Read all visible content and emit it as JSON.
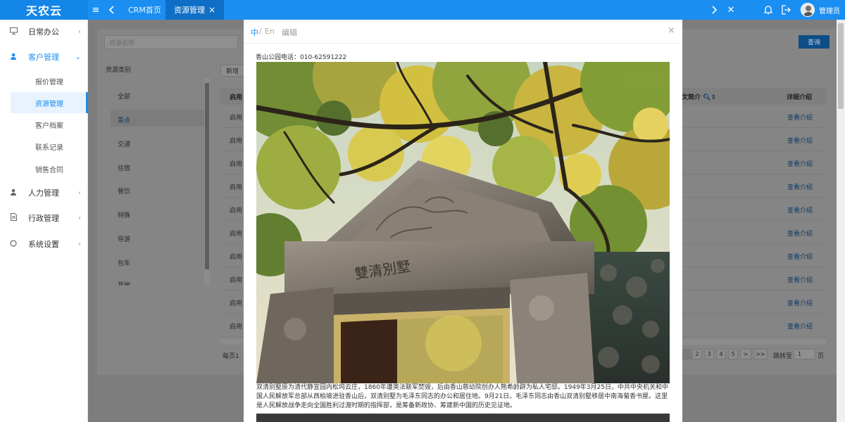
{
  "topbar": {
    "logo": "天农云",
    "tabs": [
      {
        "label": "CRM首页"
      },
      {
        "label": "资源管理",
        "close": "×"
      }
    ],
    "close_all": "✕",
    "username": "管理员"
  },
  "sidebar": {
    "items": [
      {
        "label": "日常办公",
        "icon": "monitor-icon"
      },
      {
        "label": "客户管理",
        "icon": "user-icon",
        "open": true
      },
      {
        "label": "人力管理",
        "icon": "user-icon"
      },
      {
        "label": "行政管理",
        "icon": "document-icon"
      },
      {
        "label": "系统设置",
        "icon": "circle-icon"
      }
    ],
    "sub_items": [
      {
        "label": "报价管理"
      },
      {
        "label": "资源管理",
        "active": true
      },
      {
        "label": "客户档案"
      },
      {
        "label": "联系记录"
      },
      {
        "label": "销售合同"
      }
    ]
  },
  "main": {
    "search_placeholder": "资源名称",
    "query_label": "查询",
    "category_title": "资源类别",
    "categories": [
      "全部",
      "景点",
      "交通",
      "住宿",
      "餐饮",
      "特殊",
      "导游",
      "包车",
      "其他"
    ],
    "selected_category": "景点",
    "add_label": "新增",
    "table": {
      "col_state": "启用",
      "col_brief": "文简介",
      "col_detail": "详细介绍",
      "row_state": "启用",
      "row_link": "查看介绍",
      "row_count": 10
    },
    "pagination": {
      "per_page_label": "每页",
      "per_page_value": "1",
      "pages": [
        "2",
        "3",
        "4",
        "5"
      ],
      "next": ">",
      "last": ">>",
      "jump_label": "跳转至",
      "jump_value": "1",
      "page_suffix": "页"
    }
  },
  "modal": {
    "lang_zh": "中",
    "lang_sep": "/",
    "lang_en": "En",
    "edit_label": "编辑",
    "close": "×",
    "phone_line": "香山公园电话：010-62591222",
    "inscription": "雙清別墅",
    "description": "双清别墅原为清代静宜园内松坞云庄，1860年遭英法联军焚毁，后由香山慈幼院创办人熊希龄辟为私人宅邸。1949年3月25日，中共中央机关和中国人民解放军总部从西柏坡进驻香山后，双清别墅为毛泽东同志的办公和居住地。9月21日，毛泽东同志由香山双清别墅移居中南海菊香书屋。这里是人民解放战争走向全国胜利过渡时期的指挥部，是筹备新政协、筹建新中国的历史见证地。"
  },
  "colors": {
    "primary": "#1b8ef2",
    "topbar": "#1b8ef2",
    "active_tab": "#0f6fc6",
    "overlay": "#7d7d7d"
  }
}
